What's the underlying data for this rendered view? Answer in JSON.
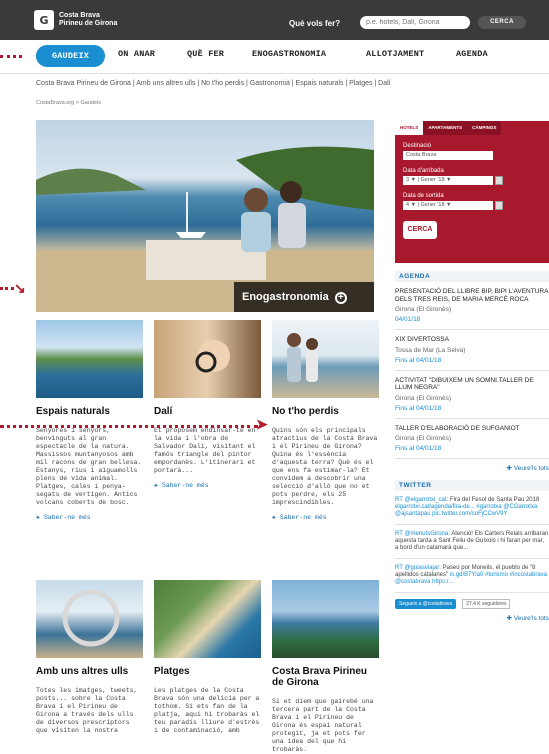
{
  "header": {
    "logo_line1": "Costa Brava",
    "logo_line2": "Pirineu de Girona",
    "question": "Què vols fer?",
    "search_placeholder": "p.e. hotels, Dalí, Girona",
    "search_button": "CERCA"
  },
  "nav": {
    "items": [
      "GAUDEIX",
      "ON ANAR",
      "QUÈ FER",
      "ENOGASTRONOMIA",
      "ALLOTJAMENT",
      "AGENDA"
    ]
  },
  "subnav": "Costa Brava Pirineu de Girona | Amb uns altres ulls | No t'ho perdis | Gastronomia | Espais naturals | Platges | Dalí",
  "breadcrumb": "CostaBrava.org  >  Gaudeix",
  "hero": {
    "label": "Enogastronomia",
    "plus": "+"
  },
  "cards": [
    {
      "title": "Espais naturals",
      "text": "Senyores i senyors, benvinguts al gran espectacle de la natura. Massissos muntanyosos amb mil racons de gran bellesa. Estanys, rius i aiguamolls plens de vida animal. Platges, cales i penya-segats de vertigen. Antics volcans coberts de bosc.",
      "more": "Saber-ne més"
    },
    {
      "title": "Dalí",
      "text": "Et proposem endinsar-te en la vida i l'obra de Salvador Dalí, visitant el famós triangle del pintor empordanès. L'itinerari et portarà...",
      "more": "Saber-ne més"
    },
    {
      "title": "No t'ho perdis",
      "text": "Quins són els principals atractius de la Costa Brava i el Pirineu de Girona? Quina és l'essència d'aquesta terra? Què és el que ens fa estimar-la? Et convidem a descobrir una selecció d'allò que no et pots perdre, els 25 imprescindibles.",
      "more": "Saber-ne més"
    },
    {
      "title": "Amb uns altres ulls",
      "text": "Totes les imatges, tweets, posts... sobre la Costa Brava i el Pirineu de Girona a través dels ulls de diversos prescriptors que visiten la nostra",
      "more": ""
    },
    {
      "title": "Platges",
      "text": "Les platges de la Costa Brava són una delícia per a tothom. Si ets fan de la platja, aquí hi trobaràs el teu paradís lliure d'estrès i de contaminació, amb",
      "more": ""
    },
    {
      "title": "Costa Brava Pirineu de Girona",
      "text": "Si et diem que gairebé una tercera part de la Costa Brava i el Pirineu de Girona és espai natural protegit, ja et pots fer una idea del que hi trobaràs.",
      "more": ""
    }
  ],
  "booking": {
    "tabs": [
      "HOTELS",
      "APARTAMENTS",
      "CÀMPINGS"
    ],
    "dest_label": "Destinació",
    "dest_value": "Costa Brava",
    "arrival_label": "Data d'arribada",
    "arrival_value": "3  ▼ | Gener '18      ▼",
    "depart_label": "Data de sortida",
    "depart_value": "4  ▼ | Gener '18      ▼",
    "button": "CERCA"
  },
  "agenda": {
    "title": "AGENDA",
    "events": [
      {
        "title": "PRESENTACIÓ DEL LLIBRE BIP, BIPI L'AVENTURA DELS TRES REIS, DE MARIA MERCÈ ROCA",
        "place": "Girona (El Gironès)",
        "date": "04/01/18"
      },
      {
        "title": "XIX DIVERTOSSA",
        "place": "Tossa de Mar (La Selva)",
        "date": "Fins al 04/01/18"
      },
      {
        "title": "ACTIVITAT \"DIBUIXEM UN SOMNI.TALLER DE LLUM NEGRA\"",
        "place": "Girona (El Gironès)",
        "date": "Fins al 04/01/18"
      },
      {
        "title": "TALLER D'ELABORACIÓ DE SUFGANIOT",
        "place": "Girona (El Gironès)",
        "date": "Fins al 04/01/18"
      }
    ],
    "more": "Veure'ls tots"
  },
  "twitter": {
    "title": "TWITTER",
    "tweets": [
      {
        "user": "RT @elgarrotxi_cat:",
        "text": "Fira del Fesol de Santa Pau 2018",
        "link": "elgarrotxi.cat/agenda/fira-de... #garrotxa @CGarrotxa @ajsantapau pic.twitter.com/soFjCCwV9Y"
      },
      {
        "user": "RT @menutsGirona:",
        "text": "Atenció! Els Carters Reials arribaran aquesta tarda a Sant Feliu de Guíxols i hi faran per mar, a bord d'un catamarà que...",
        "link": ""
      },
      {
        "user": "RT @guiasviajar:",
        "text": "Paseo por Moneils, el pueblo de \"8 apellidos catalanes\"",
        "link": "is.gd/B7Yia0 #turismo #incostabrava @costabrava https:/..."
      }
    ],
    "follow": "Segueix a @costabrava",
    "count": "27,4 K seguidores",
    "more": "Veure'ls tots"
  }
}
